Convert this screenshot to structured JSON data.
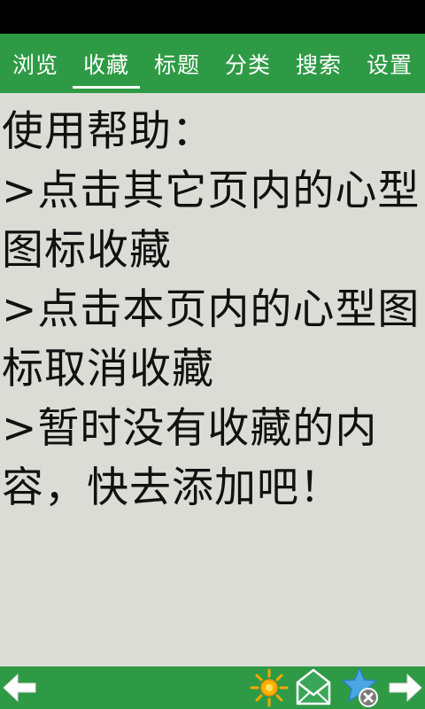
{
  "tabs": [
    {
      "label": "浏览",
      "active": false
    },
    {
      "label": "收藏",
      "active": true
    },
    {
      "label": "标题",
      "active": false
    },
    {
      "label": "分类",
      "active": false
    },
    {
      "label": "搜索",
      "active": false
    },
    {
      "label": "设置",
      "active": false
    }
  ],
  "help": {
    "title": "使用帮助：",
    "lines": [
      ">点击其它页内的心型图标收藏",
      ">点击本页内的心型图标取消收藏",
      ">暂时没有收藏的内容，快去添加吧！"
    ]
  },
  "bottom_bar": {
    "icons": [
      "arrow-left-icon",
      "sun-icon",
      "mail-icon",
      "star-remove-icon",
      "arrow-right-icon"
    ]
  },
  "colors": {
    "bar_green": "#2f9a45",
    "content_bg": "#dcdcd6",
    "text": "#111111"
  }
}
